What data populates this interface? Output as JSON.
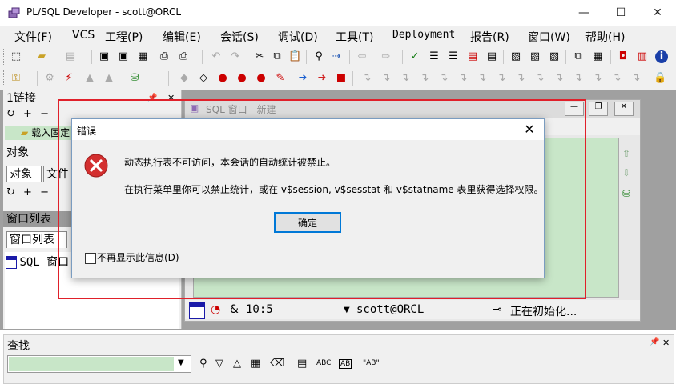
{
  "window": {
    "title": "PL/SQL Developer - scott@ORCL",
    "minimize": "—",
    "maximize": "☐",
    "close": "✕"
  },
  "menu": [
    {
      "label": "文件(",
      "key": "F",
      "end": ")"
    },
    {
      "label": "VCS",
      "key": "",
      "end": ""
    },
    {
      "label": "工程(",
      "key": "P",
      "end": ")"
    },
    {
      "label": "编辑(",
      "key": "E",
      "end": ")"
    },
    {
      "label": "会话(",
      "key": "S",
      "end": ")"
    },
    {
      "label": "调试(",
      "key": "D",
      "end": ")"
    },
    {
      "label": "工具(",
      "key": "T",
      "end": ")"
    },
    {
      "label": "Deployment",
      "key": "",
      "end": ""
    },
    {
      "label": "报告(",
      "key": "R",
      "end": ")"
    },
    {
      "label": "窗口(",
      "key": "W",
      "end": ")"
    },
    {
      "label": "帮助(",
      "key": "H",
      "end": ")"
    }
  ],
  "left_panel": {
    "connections_title": "1链接",
    "pin": "📌",
    "close": "✕",
    "load_fixed": "载入固定",
    "objects_title": "对象",
    "tab_objects": "对象",
    "tab_files": "文件",
    "windows_title": "窗口列表",
    "tab_window_list": "窗口列表",
    "window_entry": "SQL 窗口"
  },
  "sql_window": {
    "title": "SQL 窗口 - 新建",
    "status_time": "10:5",
    "status_amp": "&",
    "status_conn": "scott@ORCL",
    "status_init": "正在初始化..."
  },
  "find_bar": {
    "title": "查找",
    "abc1": "ABC",
    "abc2": "AB",
    "abc3": "\"AB\""
  },
  "dialog": {
    "title": "错误",
    "close": "✕",
    "message_line1": "动态执行表不可访问，本会话的自动统计被禁止。",
    "message_line2": "在执行菜单里你可以禁止统计，或在 v$session, v$sesstat 和 v$statname 表里获得选择权限。",
    "ok_label": "确定",
    "checkbox_label": "不再显示此信息(D)",
    "checkbox_checked": false
  },
  "colors": {
    "highlight": "#e0202a",
    "editor_bg": "#c8e6c8",
    "error_red": "#d32f2f"
  }
}
